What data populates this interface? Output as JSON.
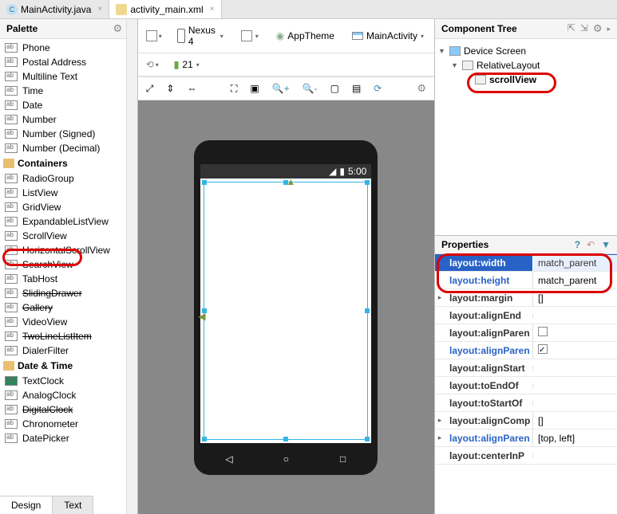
{
  "tabs": {
    "file1": "MainActivity.java",
    "file2": "activity_main.xml"
  },
  "palette": {
    "header": "Palette",
    "text_fields": [
      "Phone",
      "Postal Address",
      "Multiline Text",
      "Time",
      "Date",
      "Number",
      "Number (Signed)",
      "Number (Decimal)"
    ],
    "containers_cat": "Containers",
    "containers": [
      "RadioGroup",
      "ListView",
      "GridView",
      "ExpandableListView",
      "ScrollView",
      "HorizontalScrollView",
      "SearchView",
      "TabHost",
      "SlidingDrawer",
      "Gallery",
      "VideoView",
      "TwoLineListItem",
      "DialerFilter"
    ],
    "datetime_cat": "Date & Time",
    "datetime": [
      "TextClock",
      "AnalogClock",
      "DigitalClock",
      "Chronometer",
      "DatePicker"
    ]
  },
  "toolbar": {
    "device": "Nexus 4",
    "theme": "AppTheme",
    "activity": "MainActivity",
    "api": "21"
  },
  "phone": {
    "time": "5:00"
  },
  "component_tree": {
    "header": "Component Tree",
    "root": "Device Screen",
    "layout": "RelativeLayout",
    "child": "scrollView"
  },
  "properties": {
    "header": "Properties",
    "rows": [
      {
        "name": "layout:width",
        "value": "match_parent",
        "blue": true,
        "selected": true
      },
      {
        "name": "layout:height",
        "value": "match_parent",
        "blue": true
      },
      {
        "name": "layout:margin",
        "value": "[]",
        "expandable": true
      },
      {
        "name": "layout:alignEnd",
        "value": ""
      },
      {
        "name": "layout:alignParentEnd",
        "value": "",
        "checkbox": true,
        "truncated": "layout:alignParen"
      },
      {
        "name": "layout:alignParentStart",
        "value": "",
        "checkbox": true,
        "checked": true,
        "blue": true,
        "truncated": "layout:alignParen"
      },
      {
        "name": "layout:alignStart",
        "value": ""
      },
      {
        "name": "layout:toEndOf",
        "value": ""
      },
      {
        "name": "layout:toStartOf",
        "value": ""
      },
      {
        "name": "layout:alignComponent",
        "value": "[]",
        "expandable": true,
        "truncated": "layout:alignComp"
      },
      {
        "name": "layout:alignParent",
        "value": "[top, left]",
        "expandable": true,
        "blue": true,
        "truncated": "layout:alignParen"
      },
      {
        "name": "layout:centerInParent",
        "value": "",
        "truncated": "layout:centerInP"
      }
    ]
  },
  "bottom_tabs": {
    "design": "Design",
    "text": "Text"
  }
}
